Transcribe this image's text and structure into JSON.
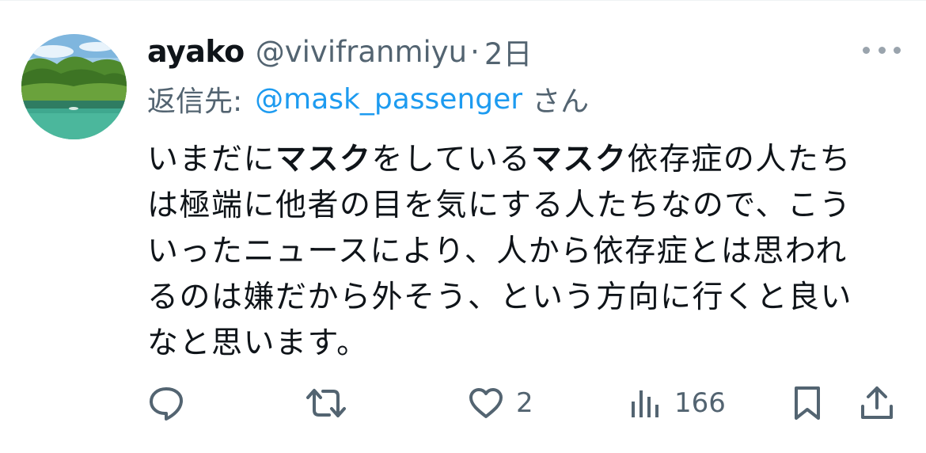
{
  "tweet": {
    "display_name": "ayako",
    "handle": "@vivifranmiyu",
    "separator": "·",
    "time": "2日",
    "reply_prefix": "返信先:",
    "reply_mention": "@mask_passenger",
    "reply_suffix": "さん",
    "body_lines": [
      {
        "a": "いまだに",
        "b": "マスク",
        "c": "をしている",
        "d": "マスク",
        "e": "依存症の人たち"
      },
      {
        "text": "は極端に他者の目を気にする人たちなので、こう"
      },
      {
        "text": "いったニュースにより、人から依存症とは思われ"
      },
      {
        "text": "るのは嫌だから外そう、という方向に行くと良い"
      },
      {
        "text": "なと思います。"
      }
    ]
  },
  "actions": {
    "reply_icon": "reply-icon",
    "retweet_icon": "retweet-icon",
    "like_icon": "heart-icon",
    "like_count": "2",
    "views_icon": "views-icon",
    "views_count": "166",
    "bookmark_icon": "bookmark-icon",
    "share_icon": "share-icon"
  },
  "colors": {
    "primary_text": "#0f1419",
    "secondary_text": "#536471",
    "link": "#1d9bf0"
  }
}
